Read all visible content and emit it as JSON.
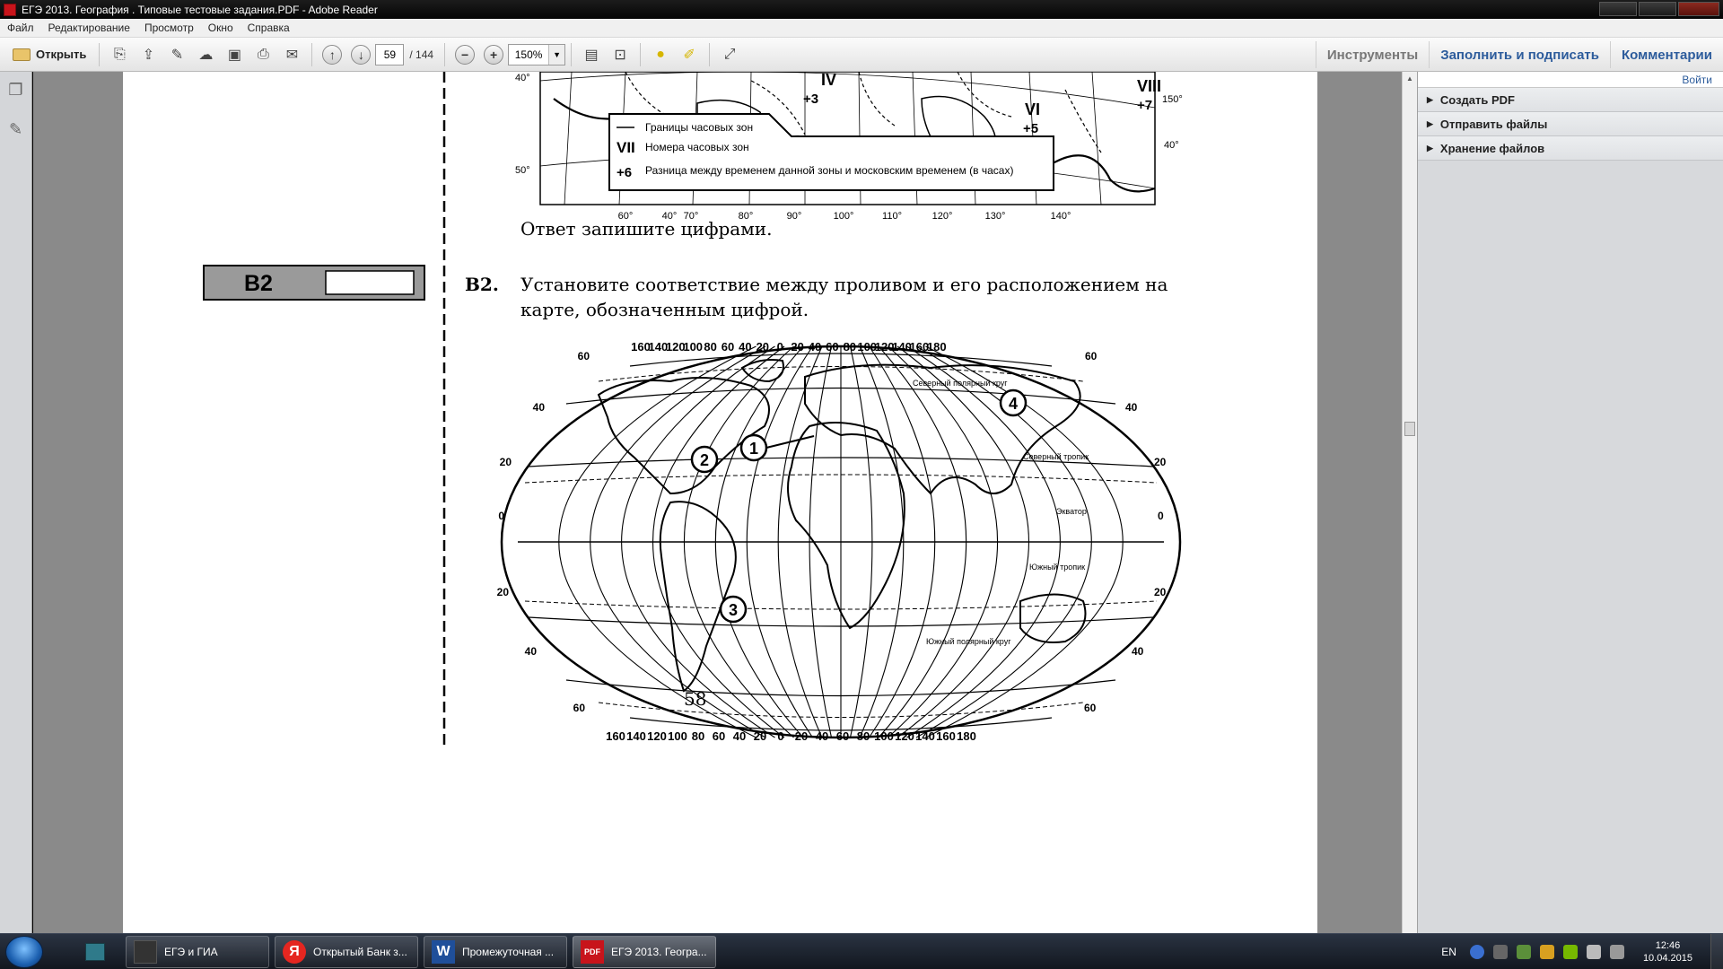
{
  "window": {
    "title": "ЕГЭ 2013. География . Типовые тестовые задания.PDF - Adobe Reader"
  },
  "menu": [
    "Файл",
    "Редактирование",
    "Просмотр",
    "Окно",
    "Справка"
  ],
  "toolbar": {
    "open_label": "Открыть",
    "page_current": "59",
    "page_total": "/ 144",
    "zoom": "150%",
    "tools_label": "Инструменты",
    "fill_sign_label": "Заполнить и подписать",
    "comments_label": "Комментарии"
  },
  "right_pane": {
    "signin": "Войти",
    "sections": [
      "Создать PDF",
      "Отправить файлы",
      "Хранение файлов"
    ]
  },
  "document": {
    "map1": {
      "lat_labels": [
        "40°",
        "50°"
      ],
      "right_labels": [
        "150°",
        "40°"
      ],
      "zones": [
        "IV",
        "+3",
        "VI",
        "+5",
        "VIII",
        "+7"
      ],
      "legend": {
        "line1": "Границы часовых зон",
        "sym2": "VII",
        "line2": "Номера часовых зон",
        "sym3": "+6",
        "line3": "Разница между временем данной зоны и московским временем (в часах)"
      },
      "lon_labels": [
        "60°",
        "40°",
        "70°",
        "80°",
        "90°",
        "100°",
        "110°",
        "120°",
        "130°",
        "140°"
      ]
    },
    "answer_note": "Ответ запишите цифрами.",
    "answer_box_label": "B2",
    "question_number": "B2.",
    "question_line1": "Установите соответствие между проливом и его расположением на",
    "question_line2": "карте, обозначенным цифрой.",
    "map2": {
      "top_lon": [
        "160",
        "140",
        "120",
        "100",
        "80",
        "60",
        "40",
        "20",
        "0",
        "20",
        "40",
        "60",
        "80",
        "100",
        "120",
        "140",
        "160",
        "180"
      ],
      "bottom_lon": [
        "160",
        "140",
        "120",
        "100",
        "80",
        "60",
        "40",
        "20",
        "0",
        "20",
        "40",
        "60",
        "80",
        "100",
        "120",
        "140",
        "160",
        "180"
      ],
      "lat_left": [
        "60",
        "40",
        "20",
        "0",
        "20",
        "40",
        "60"
      ],
      "lat_right": [
        "60",
        "40",
        "20",
        "0",
        "20",
        "40",
        "60"
      ],
      "line_labels": [
        "Северный полярный круг",
        "Северный тропик",
        "Экватор",
        "Южный тропик",
        "Южный полярный круг"
      ],
      "markers": [
        "1",
        "2",
        "3",
        "4"
      ]
    },
    "page_number": "58"
  },
  "taskbar": {
    "tasks": [
      {
        "label": "ЕГЭ и ГИА",
        "icon": "folder-icon"
      },
      {
        "label": "Открытый Банк з...",
        "icon": "yandex-icon"
      },
      {
        "label": "Промежуточная ...",
        "icon": "word-icon"
      },
      {
        "label": "ЕГЭ 2013. Геогра...",
        "icon": "pdf-icon"
      }
    ],
    "lang": "EN",
    "time": "12:46",
    "date": "10.04.2015"
  }
}
